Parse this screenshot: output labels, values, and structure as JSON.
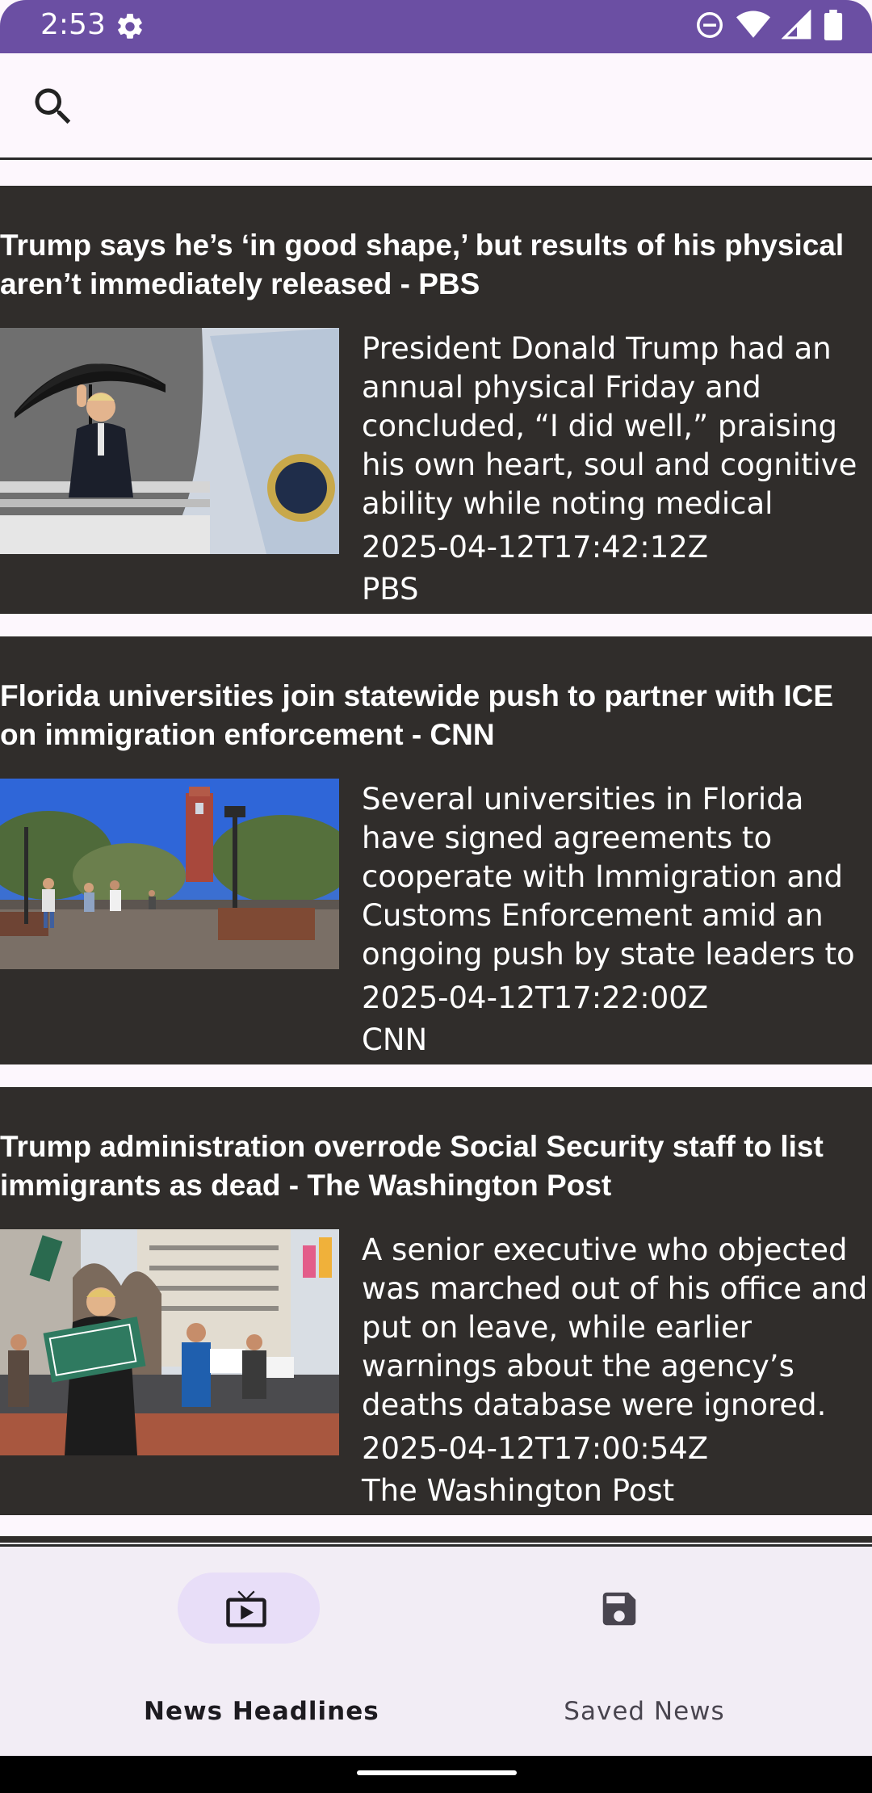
{
  "status_bar": {
    "time": "2:53",
    "icons": [
      "gear-icon",
      "do-not-disturb-icon",
      "wifi-icon",
      "signal-icon",
      "battery-icon"
    ]
  },
  "search": {
    "placeholder": "",
    "value": ""
  },
  "articles": [
    {
      "title": "Trump says he’s ‘in good shape,’ but results of his physical aren’t immediately released - PBS",
      "description": "President Donald Trump had an annual physical Friday and concluded, “I did well,” praising his own heart, soul and cognitive ability while noting medical",
      "published_at": "2025-04-12T17:42:12Z",
      "source": "PBS",
      "image": "photo-man-with-umbrella-on-airplane-stairs"
    },
    {
      "title": "Florida universities join statewide push to partner with ICE on immigration enforcement - CNN",
      "description": "Several universities in Florida have signed agreements to cooperate with Immigration and Customs Enforcement amid an ongoing push by state leaders to aid the",
      "published_at": "2025-04-12T17:22:00Z",
      "source": "CNN",
      "image": "photo-university-campus-with-tower"
    },
    {
      "title": "Trump administration overrode Social Security staff to list immigrants as dead - The Washington Post",
      "description": "A senior executive who objected was marched out of his office and put on leave, while earlier warnings about the agency’s deaths database were ignored.",
      "published_at": "2025-04-12T17:00:54Z",
      "source": "The Washington Post",
      "image": "photo-protesters-with-hands-off-social-security-sign"
    }
  ],
  "bottom_nav": {
    "items": [
      {
        "label": "News Headlines",
        "icon": "tv-play-icon",
        "selected": true
      },
      {
        "label": "Saved News",
        "icon": "save-floppy-icon",
        "selected": false
      }
    ]
  },
  "colors": {
    "status_bar": "#6b4fa3",
    "card_background": "#302d2b",
    "nav_background": "#f2edf5",
    "nav_selected_pill": "#e8def8"
  }
}
